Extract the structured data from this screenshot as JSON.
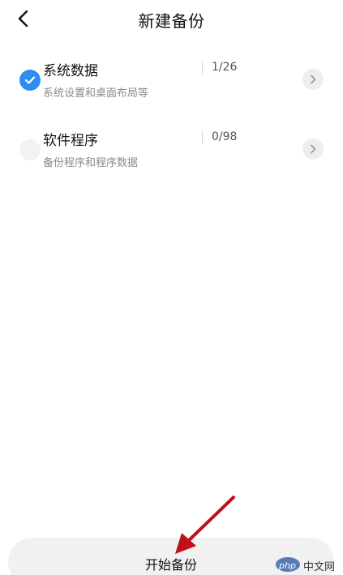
{
  "header": {
    "title": "新建备份",
    "back_icon": "chevron-left-icon"
  },
  "items": [
    {
      "title": "系统数据",
      "subtitle": "系统设置和桌面布局等",
      "count": "1/26",
      "checked": true
    },
    {
      "title": "软件程序",
      "subtitle": "备份程序和程序数据",
      "count": "0/98",
      "checked": false
    }
  ],
  "bottom": {
    "start_label": "开始备份"
  },
  "watermark": {
    "logo_text": "php",
    "site_text": "中文网"
  },
  "colors": {
    "accent": "#2f8cf0",
    "annotation_arrow": "#c0101a",
    "button_bg": "#f1f1f1"
  }
}
